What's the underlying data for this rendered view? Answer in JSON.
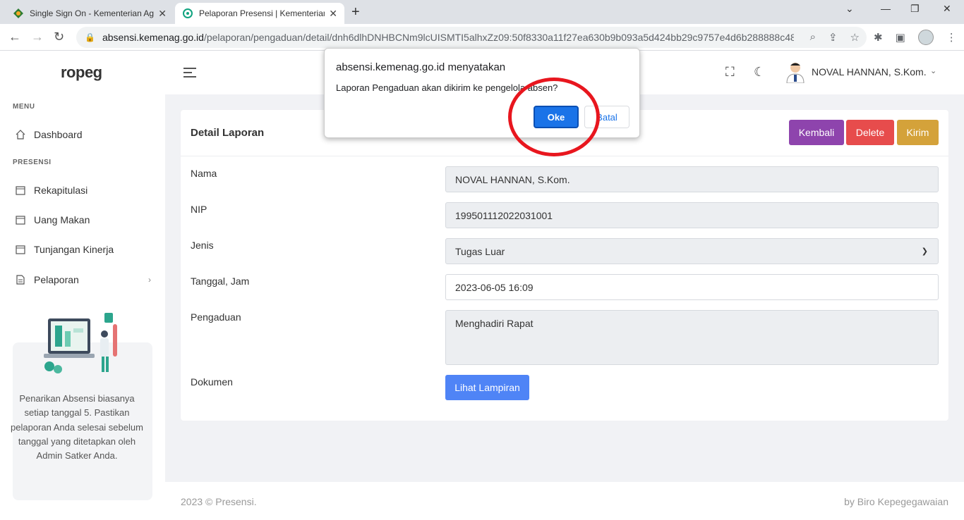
{
  "browser": {
    "tabs": [
      {
        "title": "Single Sign On - Kementerian Agama",
        "active": false
      },
      {
        "title": "Pelaporan Presensi | Kementerian Agama",
        "active": true
      }
    ],
    "url_host": "absensi.kemenag.go.id",
    "url_path": "/pelaporan/pengaduan/detail/dnh6dlhDNHBCNm9lcUISMTI5alhxZz09:50f8330a11f27ea630b9b093a5d424bb29c9757e4d6b288888c48..."
  },
  "sidebar": {
    "logo": "ropeg",
    "menu_header": "MENU",
    "presensi_header": "PRESENSI",
    "items": [
      {
        "label": "Dashboard"
      },
      {
        "label": "Rekapitulasi"
      },
      {
        "label": "Uang Makan"
      },
      {
        "label": "Tunjangan Kinerja"
      },
      {
        "label": "Pelaporan"
      }
    ],
    "promo_text": "Penarikan Absensi biasanya setiap tanggal 5. Pastikan pelaporan Anda selesai sebelum tanggal yang ditetapkan oleh Admin Satker Anda."
  },
  "topbar": {
    "user_name": "NOVAL HANNAN, S.Kom."
  },
  "card": {
    "title": "Detail Laporan",
    "buttons": {
      "kembali": "Kembali",
      "delete": "Delete",
      "kirim": "Kirim"
    },
    "fields": {
      "nama_label": "Nama",
      "nama_value": "NOVAL HANNAN, S.Kom.",
      "nip_label": "NIP",
      "nip_value": "199501112022031001",
      "jenis_label": "Jenis",
      "jenis_value": "Tugas Luar",
      "tanggal_label": "Tanggal, Jam",
      "tanggal_value": "2023-06-05 16:09",
      "pengaduan_label": "Pengaduan",
      "pengaduan_value": "Menghadiri Rapat",
      "dokumen_label": "Dokumen",
      "lampiran_button": "Lihat Lampiran"
    }
  },
  "footer": {
    "left": "2023 © Presensi.",
    "right": "by Biro Kepegegawaian"
  },
  "dialog": {
    "title": "absensi.kemenag.go.id menyatakan",
    "message": "Laporan Pengaduan akan dikirim ke pengelola absen?",
    "ok": "Oke",
    "cancel": "Batal"
  },
  "colors": {
    "accent": "#1a73e8",
    "kembali": "#8e44ad",
    "delete": "#e74c4c",
    "kirim": "#d4a23a",
    "lampiran": "#4f84f6",
    "annotation": "#e8161e"
  }
}
